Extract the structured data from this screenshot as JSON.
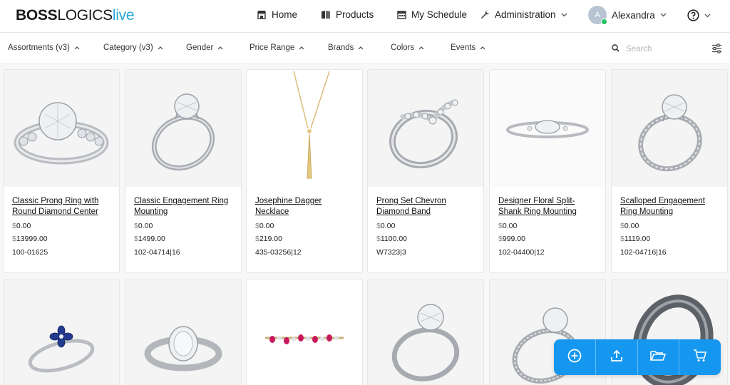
{
  "logo": {
    "part1": "BOSS",
    "part2": "LOGICS",
    "part3": "live"
  },
  "nav": {
    "home": "Home",
    "products": "Products",
    "schedule": "My Schedule",
    "administration": "Administration",
    "avatar_initial": "A",
    "user": "Alexandra"
  },
  "filters": [
    {
      "label": "Assortments (v3)"
    },
    {
      "label": "Category (v3)"
    },
    {
      "label": "Gender"
    },
    {
      "label": "Price Range"
    },
    {
      "label": "Brands"
    },
    {
      "label": "Colors"
    },
    {
      "label": "Events"
    }
  ],
  "search": {
    "placeholder": "Search"
  },
  "products": [
    {
      "name": "Classic Prong Ring with Round Diamond Center",
      "currency": "$",
      "price1": "0.00",
      "price2": "13999.00",
      "sku": "100-01625",
      "image": "ring-icon"
    },
    {
      "name": "Classic Engagement Ring Mounting",
      "currency": "$",
      "price1": "0.00",
      "price2": "1499.00",
      "sku": "102-04714|16",
      "image": "ring-icon"
    },
    {
      "name": "Josephine Dagger Necklace",
      "currency": "$",
      "price1": "0.00",
      "price2": "219.00",
      "sku": "435-03256|12",
      "image": "necklace-icon"
    },
    {
      "name": "Prong Set Chevron Diamond Band",
      "currency": "$",
      "price1": "0.00",
      "price2": "1100.00",
      "sku": "W7323|3",
      "image": "band-icon"
    },
    {
      "name": "Designer Floral Split-Shank Ring Mounting",
      "currency": "$",
      "price1": "0.00",
      "price2": "999.00",
      "sku": "102-04400|12",
      "image": "ring-icon"
    },
    {
      "name": "Scalloped Engagement Ring Mounting",
      "currency": "$",
      "price1": "0.00",
      "price2": "1119.00",
      "sku": "102-04716|16",
      "image": "ring-icon"
    }
  ],
  "colors": {
    "accent": "#1597f0",
    "logo_live": "#2aa7d8",
    "online": "#22c55e"
  }
}
